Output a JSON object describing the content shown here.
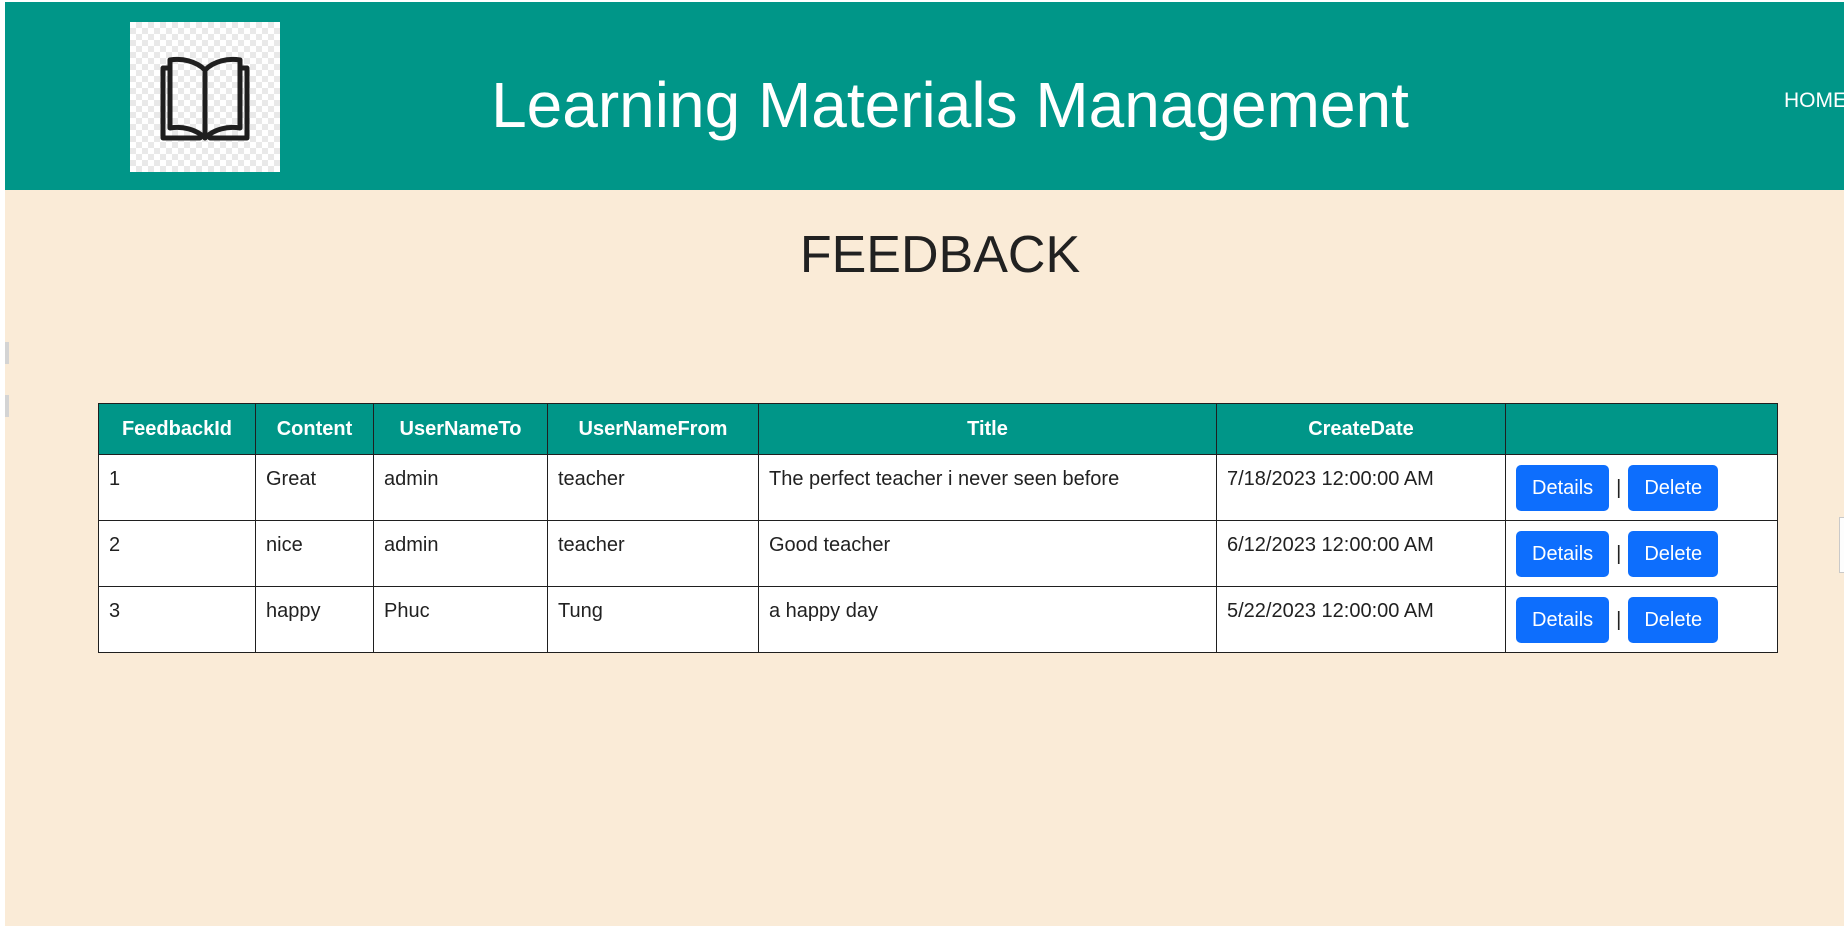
{
  "header": {
    "title": "Learning Materials Management",
    "nav": {
      "home": "HOME"
    },
    "logo_icon": "open-book-icon"
  },
  "page": {
    "title": "FEEDBACK"
  },
  "table": {
    "columns": [
      "FeedbackId",
      "Content",
      "UserNameTo",
      "UserNameFrom",
      "Title",
      "CreateDate",
      ""
    ],
    "rows": [
      {
        "id": "1",
        "content": "Great",
        "to": "admin",
        "from": "teacher",
        "title": "The perfect teacher i never seen before",
        "date": "7/18/2023 12:00:00 AM"
      },
      {
        "id": "2",
        "content": "nice",
        "to": "admin",
        "from": "teacher",
        "title": "Good teacher",
        "date": "6/12/2023 12:00:00 AM"
      },
      {
        "id": "3",
        "content": "happy",
        "to": "Phuc",
        "from": "Tung",
        "title": "a happy day",
        "date": "5/22/2023 12:00:00 AM"
      }
    ],
    "actions": {
      "details": "Details",
      "separator": "|",
      "delete": "Delete"
    }
  },
  "colors": {
    "header": "#009688",
    "page_background": "#faebd7",
    "button": "#0d6efd"
  }
}
